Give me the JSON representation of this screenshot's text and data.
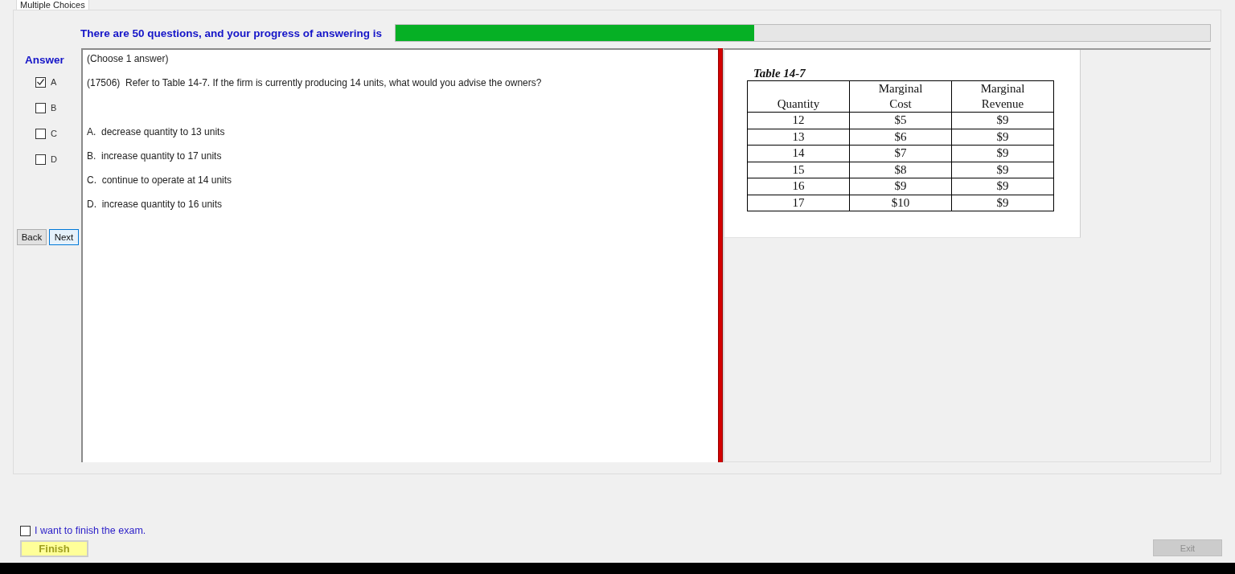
{
  "tab": {
    "label": "Multiple Choices",
    "selected": true
  },
  "header": {
    "text": "There are 50 questions, and your progress of answering is",
    "progress": {
      "level": 0.44
    }
  },
  "answer_panel": {
    "title": "Answer",
    "choices": [
      {
        "label": "A",
        "checked": true
      },
      {
        "label": "B",
        "checked": false
      },
      {
        "label": "C",
        "checked": false
      },
      {
        "label": "D",
        "checked": false
      }
    ],
    "buttons": [
      {
        "label": "Back",
        "focused": false
      },
      {
        "label": "Next",
        "focused": true
      }
    ]
  },
  "question": {
    "instruction": "(Choose 1 answer)",
    "text": "(17506)  Refer to Table 14-7. If the firm is currently producing 14 units, what would you advise the owners?",
    "options": [
      "A.  decrease quantity to 13 units",
      "B.  increase quantity to 17 units",
      "C.  continue to operate at 14 units",
      "D.  increase quantity to 16 units"
    ]
  },
  "exhibit": {
    "title": "Table 14-7",
    "columns": [
      "Quantity",
      "Marginal\nCost",
      "Marginal\nRevenue"
    ],
    "rows": [
      [
        "12",
        "$5",
        "$9"
      ],
      [
        "13",
        "$6",
        "$9"
      ],
      [
        "14",
        "$7",
        "$9"
      ],
      [
        "15",
        "$8",
        "$9"
      ],
      [
        "16",
        "$9",
        "$9"
      ],
      [
        "17",
        "$10",
        "$9"
      ]
    ]
  },
  "finish": {
    "confirm": {
      "label": "I want to finish the exam.",
      "checked": false
    },
    "button": "Finish"
  },
  "exit": {
    "label": "Exit",
    "disabled": true
  }
}
